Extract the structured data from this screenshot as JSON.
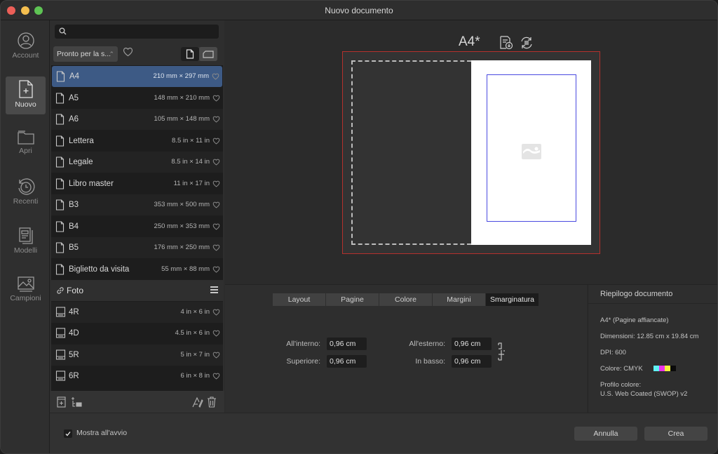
{
  "window": {
    "title": "Nuovo documento"
  },
  "nav": [
    {
      "label": "Account",
      "icon": "account-icon"
    },
    {
      "label": "Nuovo",
      "icon": "new-document-icon",
      "active": true
    },
    {
      "label": "Apri",
      "icon": "folder-icon"
    },
    {
      "label": "Recenti",
      "icon": "recent-icon"
    },
    {
      "label": "Modelli",
      "icon": "templates-icon"
    },
    {
      "label": "Campioni",
      "icon": "samples-icon"
    }
  ],
  "list_panel": {
    "search": {
      "placeholder": "",
      "value": ""
    },
    "filter": {
      "selected": "Pronto per la s..."
    },
    "orientation": {
      "selected": "portrait"
    },
    "presets": [
      {
        "name": "A4",
        "size": "210 mm × 297 mm",
        "selected": true
      },
      {
        "name": "A5",
        "size": "148 mm × 210 mm"
      },
      {
        "name": "A6",
        "size": "105 mm × 148 mm"
      },
      {
        "name": "Lettera",
        "size": "8.5 in × 11 in"
      },
      {
        "name": "Legale",
        "size": "8.5 in × 14 in"
      },
      {
        "name": "Libro master",
        "size": "11 in × 17 in"
      },
      {
        "name": "B3",
        "size": "353 mm × 500 mm"
      },
      {
        "name": "B4",
        "size": "250 mm × 353 mm"
      },
      {
        "name": "B5",
        "size": "176 mm × 250 mm"
      },
      {
        "name": "Biglietto da visita",
        "size": "55 mm × 88 mm"
      }
    ],
    "group": {
      "name": "Foto"
    },
    "photo_presets": [
      {
        "name": "4R",
        "size": "4 in × 6 in"
      },
      {
        "name": "4D",
        "size": "4.5 in × 6 in"
      },
      {
        "name": "5R",
        "size": "5 in × 7 in"
      },
      {
        "name": "6R",
        "size": "6 in × 8 in"
      }
    ]
  },
  "preview": {
    "doc_title": "A4*"
  },
  "tabs": [
    {
      "label": "Layout"
    },
    {
      "label": "Pagine"
    },
    {
      "label": "Colore"
    },
    {
      "label": "Margini"
    },
    {
      "label": "Smarginatura",
      "active": true
    }
  ],
  "bleed": {
    "inside_label": "All'interno:",
    "inside_value": "0,96 cm",
    "top_label": "Superiore:",
    "top_value": "0,96 cm",
    "outside_label": "All'esterno:",
    "outside_value": "0,96 cm",
    "bottom_label": "In basso:",
    "bottom_value": "0,96 cm"
  },
  "summary": {
    "heading": "Riepilogo documento",
    "name": "A4* (Pagine affiancate)",
    "dimensions": "Dimensioni: 12.85 cm x 19.84 cm",
    "dpi": "DPI:  600",
    "color": "Colore: CMYK",
    "swatches": [
      "#5ff3f5",
      "#ea33ea",
      "#f3f33c",
      "#0a0a0a"
    ],
    "profile_label": "Profilo colore:",
    "profile_value": "U.S. Web Coated (SWOP) v2"
  },
  "footer": {
    "show_on_start_label": "Mostra all'avvio",
    "show_on_start_checked": true,
    "cancel_label": "Annulla",
    "create_label": "Crea"
  }
}
